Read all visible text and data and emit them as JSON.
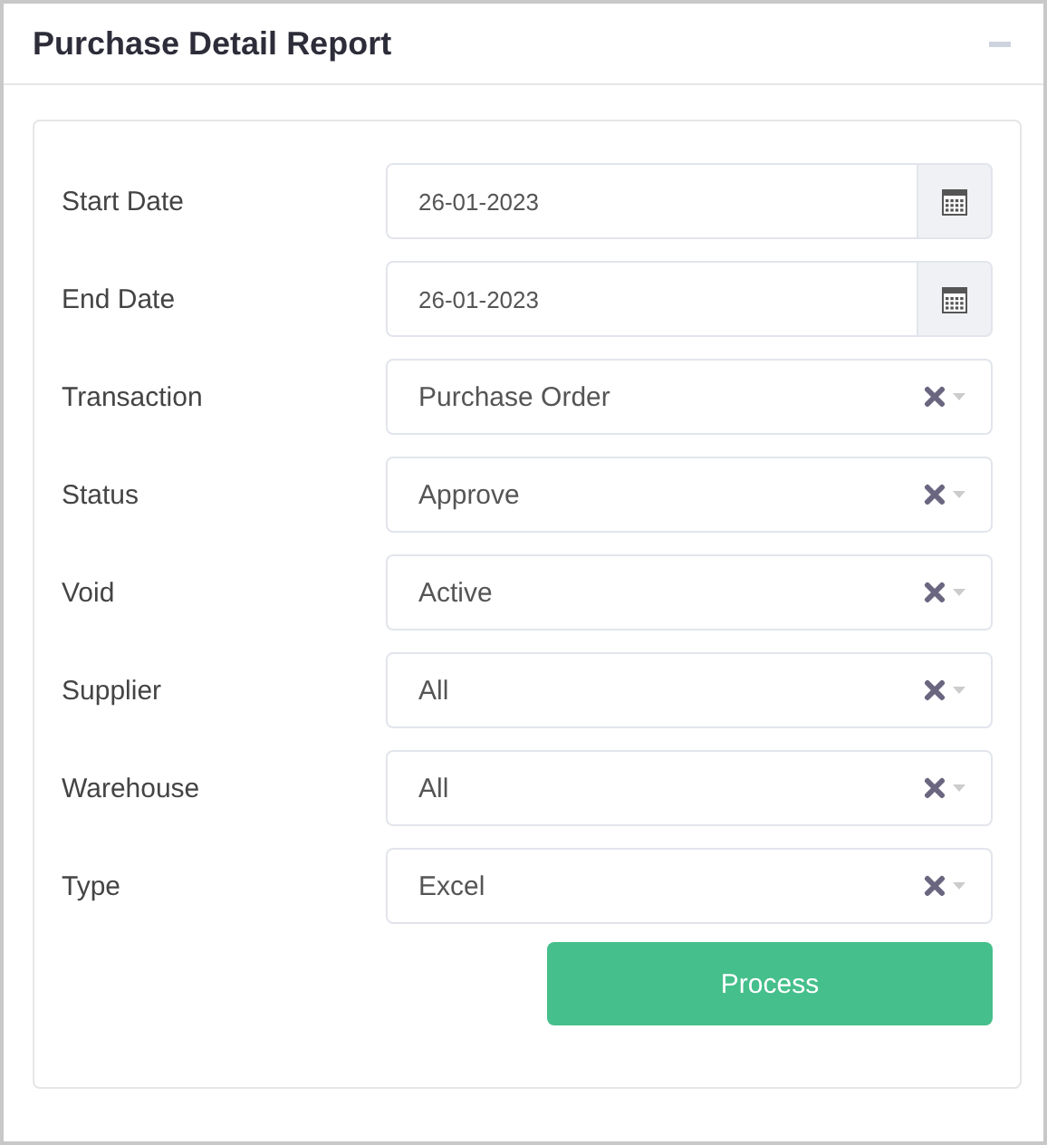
{
  "panel": {
    "title": "Purchase Detail Report"
  },
  "fields": [
    {
      "label": "Start Date",
      "kind": "date",
      "value": "26-01-2023"
    },
    {
      "label": "End Date",
      "kind": "date",
      "value": "26-01-2023"
    },
    {
      "label": "Transaction",
      "kind": "select",
      "value": "Purchase Order"
    },
    {
      "label": "Status",
      "kind": "select",
      "value": "Approve"
    },
    {
      "label": "Void",
      "kind": "select",
      "value": "Active"
    },
    {
      "label": "Supplier",
      "kind": "select",
      "value": "All"
    },
    {
      "label": "Warehouse",
      "kind": "select",
      "value": "All"
    },
    {
      "label": "Type",
      "kind": "select",
      "value": "Excel"
    }
  ],
  "buttons": [
    "Process"
  ]
}
